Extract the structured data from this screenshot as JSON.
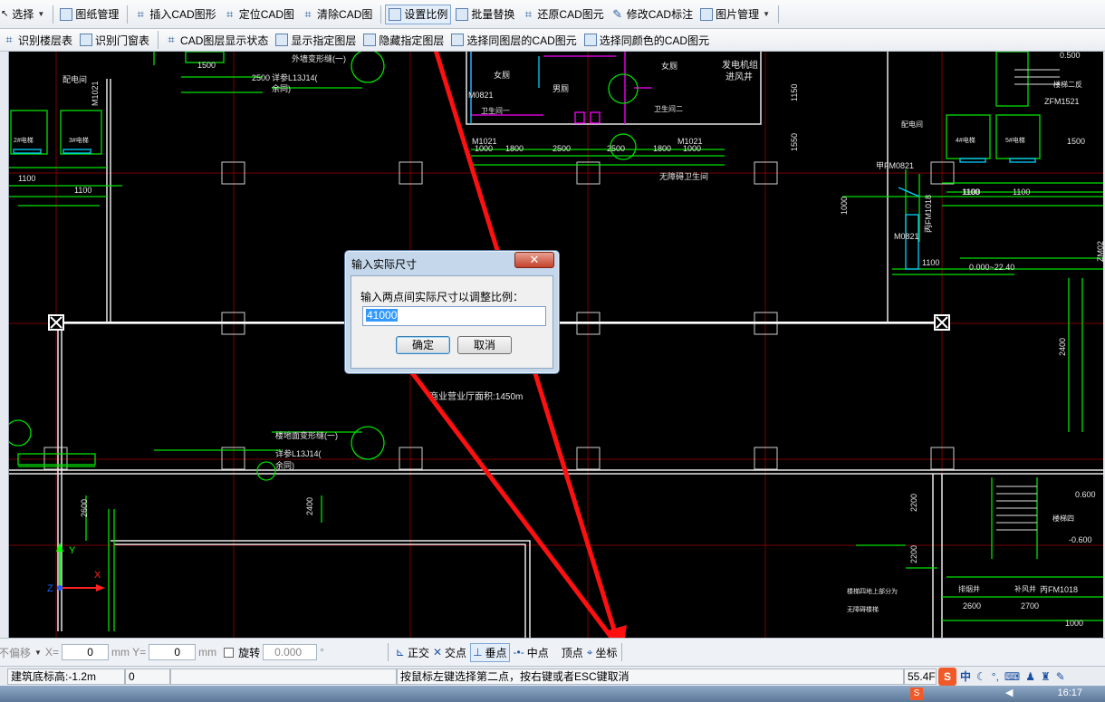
{
  "toolbar1": {
    "select_label": "选择",
    "items": [
      {
        "label": "图纸管理"
      },
      {
        "label": "插入CAD图形"
      },
      {
        "label": "定位CAD图"
      },
      {
        "label": "清除CAD图"
      },
      {
        "label": "设置比例"
      },
      {
        "label": "批量替换"
      },
      {
        "label": "还原CAD图元"
      },
      {
        "label": "修改CAD标注"
      },
      {
        "label": "图片管理"
      }
    ]
  },
  "toolbar2": {
    "items": [
      {
        "label": "识别楼层表"
      },
      {
        "label": "识别门窗表"
      },
      {
        "label": "CAD图层显示状态"
      },
      {
        "label": "显示指定图层"
      },
      {
        "label": "隐藏指定图层"
      },
      {
        "label": "选择同图层的CAD图元"
      },
      {
        "label": "选择同颜色的CAD图元"
      }
    ]
  },
  "drawing": {
    "texts": [
      "外墙变形缝(一)",
      "详参L13J14(",
      "余同)",
      "配电间",
      "2#电梯",
      "3#电梯",
      "女厕",
      "男厕",
      "女厕",
      "发电机组",
      "进风井",
      "楼梯二反",
      "配电间",
      "M1021",
      "M0821",
      "M1021",
      "M1021",
      "卫生间一",
      "卫生间二",
      "无障碍卫生间",
      "甲FM0821",
      "M0821",
      "丙FM1018",
      "4#电梯",
      "5#电梯",
      "ZFM1521",
      "0.000~22.40",
      "商业营业厅面积:1450m",
      "楼地面变形缝(一)",
      "详参L13J14(",
      "余同)",
      "楼梯四",
      "0.600",
      "-0.600",
      "排烟井",
      "补风井",
      "丙FM1018",
      "楼梯四地上部分为",
      "无障碍楼梯",
      "ZM02"
    ],
    "dims": [
      "1500",
      "2500",
      "1100",
      "1100",
      "1100",
      "1800",
      "2500",
      "2500",
      "1800",
      "1000",
      "1000",
      "1150",
      "1550",
      "1000",
      "1100",
      "1100",
      "1100",
      "1500",
      "0.500",
      "2400",
      "2600",
      "2400",
      "2200",
      "2200",
      "2600",
      "2700",
      "1000"
    ]
  },
  "dialog": {
    "title": "输入实际尺寸",
    "close_label": "✕",
    "prompt": "输入两点间实际尺寸以调整比例：",
    "value": "41000",
    "ok_label": "确定",
    "cancel_label": "取消"
  },
  "coordbar": {
    "offset_label": "不偏移",
    "x_label": "X=",
    "x_value": "0",
    "y_label": "mm Y=",
    "y_value": "0",
    "y_unit": "mm",
    "rotate_label": "旋转",
    "rotate_value": "0.000",
    "deg": "°",
    "snaps": [
      "正交",
      "交点",
      "垂点",
      "中点",
      "顶点",
      "坐标"
    ]
  },
  "statusbar": {
    "elevation": "建筑底标高:-1.2m",
    "count": "0",
    "hint": "按鼠标左键选择第二点，按右键或者ESC键取消",
    "fps": "55.4FP",
    "ime": "中"
  },
  "taskbar": {
    "time": "16:17"
  },
  "colors": {
    "annotation_arrow": "#ff1010",
    "cad_green": "#00ff00",
    "cad_red_grid": "#8b0000",
    "cad_magenta": "#ff00ff",
    "cad_cyan": "#00ffff"
  }
}
